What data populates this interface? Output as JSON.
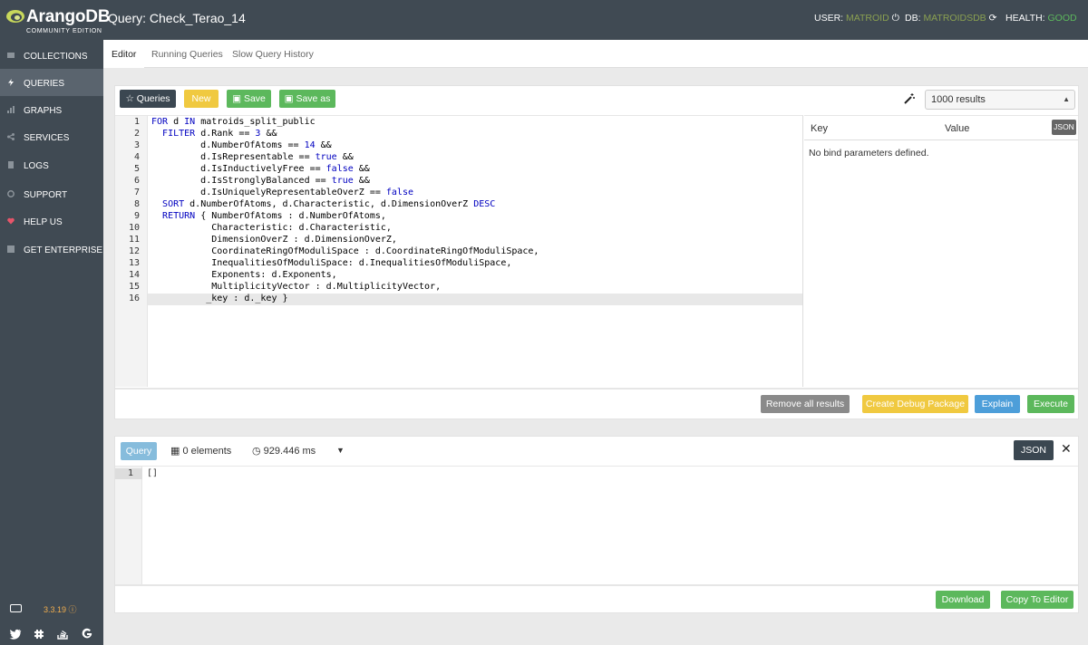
{
  "header": {
    "brand": "ArangoDB",
    "edition": "COMMUNITY EDITION",
    "title": "Query: Check_Terao_14",
    "user_label": "USER:",
    "user_value": "MATROID",
    "db_label": "DB:",
    "db_value": "MATROIDSDB",
    "health_label": "HEALTH:",
    "health_value": "GOOD"
  },
  "sidebar": {
    "items": [
      {
        "label": "COLLECTIONS",
        "icon": "folder-icon"
      },
      {
        "label": "QUERIES",
        "icon": "bolt-icon"
      },
      {
        "label": "GRAPHS",
        "icon": "graph-icon"
      },
      {
        "label": "SERVICES",
        "icon": "share-icon"
      },
      {
        "label": "LOGS",
        "icon": "file-icon"
      },
      {
        "label": "SUPPORT",
        "icon": "lifebuoy-icon"
      },
      {
        "label": "HELP US",
        "icon": "heart-icon"
      },
      {
        "label": "GET ENTERPRISE",
        "icon": "external-link-icon"
      }
    ],
    "version": "3.3.19"
  },
  "tabs": [
    "Editor",
    "Running Queries",
    "Slow Query History"
  ],
  "toolbar": {
    "queries": "Queries",
    "new": "New",
    "save": "Save",
    "save_as": "Save as",
    "limit": "1000 results"
  },
  "code_lines": [
    "FOR d IN matroids_split_public",
    "  FILTER d.Rank == 3 &&",
    "         d.NumberOfAtoms == 14 &&",
    "         d.IsRepresentable == true &&",
    "         d.IsInductivelyFree == false &&",
    "         d.IsStronglyBalanced == true &&",
    "         d.IsUniquelyRepresentableOverZ == false",
    "  SORT d.NumberOfAtoms, d.Characteristic, d.DimensionOverZ DESC",
    "  RETURN { NumberOfAtoms : d.NumberOfAtoms,",
    "           Characteristic: d.Characteristic,",
    "           DimensionOverZ : d.DimensionOverZ,",
    "           CoordinateRingOfModuliSpace : d.CoordinateRingOfModuliSpace,",
    "           InequalitiesOfModuliSpace: d.InequalitiesOfModuliSpace,",
    "           Exponents: d.Exponents,",
    "           MultiplicityVector : d.MultiplicityVector,",
    "          _key : d._key }"
  ],
  "bind": {
    "key_header": "Key",
    "value_header": "Value",
    "json_button": "JSON",
    "empty_text": "No bind parameters defined."
  },
  "actions": {
    "remove_all": "Remove all results",
    "debug": "Create Debug Package",
    "explain": "Explain",
    "execute": "Execute"
  },
  "result": {
    "tag": "Query",
    "elements": "0 elements",
    "time": "929.446 ms",
    "json_button": "JSON",
    "line_number": "1",
    "content": "[]",
    "download": "Download",
    "copy": "Copy To Editor"
  },
  "colors": {
    "sidebar": "#404a53",
    "accent_green": "#5cb85c",
    "accent_yellow": "#f0c940",
    "accent_blue": "#4d9ed9"
  }
}
